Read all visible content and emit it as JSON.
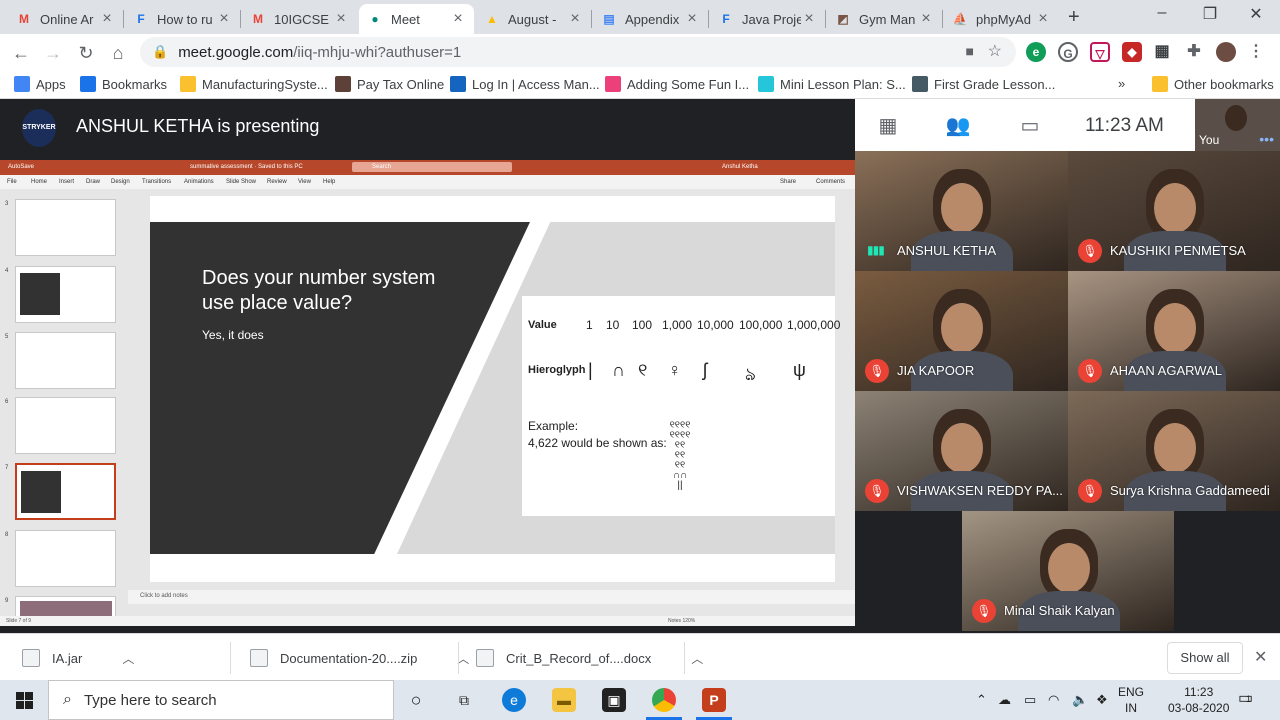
{
  "browser": {
    "tabs": [
      {
        "label": "Online Ar",
        "icon": "gmail-icon",
        "color": "#ea4335",
        "glyph": "M",
        "active": false
      },
      {
        "label": "How to ru",
        "icon": "f-icon",
        "color": "#1a73e8",
        "glyph": "F",
        "active": false
      },
      {
        "label": "10IGCSE I",
        "icon": "gmail-icon",
        "color": "#ea4335",
        "glyph": "M",
        "active": false
      },
      {
        "label": "Meet",
        "icon": "meet-icon",
        "color": "#00897b",
        "glyph": "●",
        "active": true
      },
      {
        "label": "August - ",
        "icon": "drive-icon",
        "color": "#fbbc04",
        "glyph": "▲",
        "active": false
      },
      {
        "label": "Appendix",
        "icon": "docs-icon",
        "color": "#4285f4",
        "glyph": "▤",
        "active": false
      },
      {
        "label": "Java Proje",
        "icon": "f-icon",
        "color": "#1a73e8",
        "glyph": "F",
        "active": false
      },
      {
        "label": "Gym Man",
        "icon": "gym-icon",
        "color": "#795548",
        "glyph": "◩",
        "active": false
      },
      {
        "label": "phpMyAd",
        "icon": "phpmyadmin-icon",
        "color": "#f57c00",
        "glyph": "⛵",
        "active": false
      }
    ],
    "new_tab": "+",
    "url_host": "meet.google.com",
    "url_path": "/iiq-mhju-whi?authuser=1",
    "bookmarks": [
      {
        "label": "Apps",
        "color": "#4285f4"
      },
      {
        "label": "Bookmarks",
        "color": "#1a73e8"
      },
      {
        "label": "ManufacturingSyste...",
        "color": "#fbc02d"
      },
      {
        "label": "Pay Tax Online",
        "color": "#5d4037"
      },
      {
        "label": "Log In | Access Man...",
        "color": "#1565c0"
      },
      {
        "label": "Adding Some Fun I...",
        "color": "#ec407a"
      },
      {
        "label": "Mini Lesson Plan: S...",
        "color": "#26c6da"
      },
      {
        "label": "First Grade Lesson...",
        "color": "#455a64"
      }
    ],
    "bookmarks_overflow": "»",
    "other_bookmarks": "Other bookmarks"
  },
  "meet": {
    "presenter_text": "ANSHUL KETHA is presenting",
    "presenter_logo": "STRYKER",
    "clock": "11:23  AM",
    "you_label": "You",
    "participants": [
      {
        "name": "ANSHUL KETHA",
        "muted": false,
        "bg": "#8a7058"
      },
      {
        "name": "KAUSHIKI PENMETSA",
        "muted": true,
        "bg": "#5b4a3d"
      },
      {
        "name": "JIA KAPOOR",
        "muted": true,
        "bg": "#7a5c40"
      },
      {
        "name": "AHAAN AGARWAL",
        "muted": true,
        "bg": "#a89482"
      },
      {
        "name": "VISHWAKSEN REDDY PA...",
        "muted": true,
        "bg": "#8c8275"
      },
      {
        "name": "Surya Krishna Gaddameedi",
        "muted": true,
        "bg": "#7d6a58"
      },
      {
        "name": "Minal Shaik Kalyan",
        "muted": true,
        "bg": "#a39583"
      }
    ]
  },
  "ppt": {
    "autosave": "AutoSave",
    "doc_title": "summative assessment · Saved to this PC",
    "search": "Search",
    "user": "Anshul Ketha",
    "menu": [
      "File",
      "Home",
      "Insert",
      "Draw",
      "Design",
      "Transitions",
      "Animations",
      "Slide Show",
      "Review",
      "View",
      "Help"
    ],
    "share": "Share",
    "comments": "Comments",
    "thumb_numbers": [
      "3",
      "4",
      "5",
      "6",
      "7",
      "8",
      "9"
    ],
    "notes_placeholder": "Click to add notes",
    "status_left": "Slide 7 of 9",
    "status_right": "Notes    120%",
    "slide": {
      "title": "Does your number system use place value?",
      "body": "Yes, it does",
      "value_label": "Value",
      "hieroglyph_label": "Hieroglyph",
      "values": [
        "1",
        "10",
        "100",
        "1,000",
        "10,000",
        "100,000",
        "1,000,000"
      ],
      "glyphs": [
        "|",
        "∩",
        "୧",
        "♀",
        "ʃ",
        "ঌ",
        "ψ"
      ],
      "example_title": "Example:",
      "example_text": "4,622 would be shown as:"
    }
  },
  "downloads": {
    "files": [
      "IA.jar",
      "Documentation-20....zip",
      "Crit_B_Record_of....docx"
    ],
    "show_all": "Show all"
  },
  "taskbar": {
    "search_placeholder": "Type here to search",
    "lang_top": "ENG",
    "lang_bottom": "IN",
    "time": "11:23",
    "date": "03-08-2020",
    "notification_count": "1"
  }
}
